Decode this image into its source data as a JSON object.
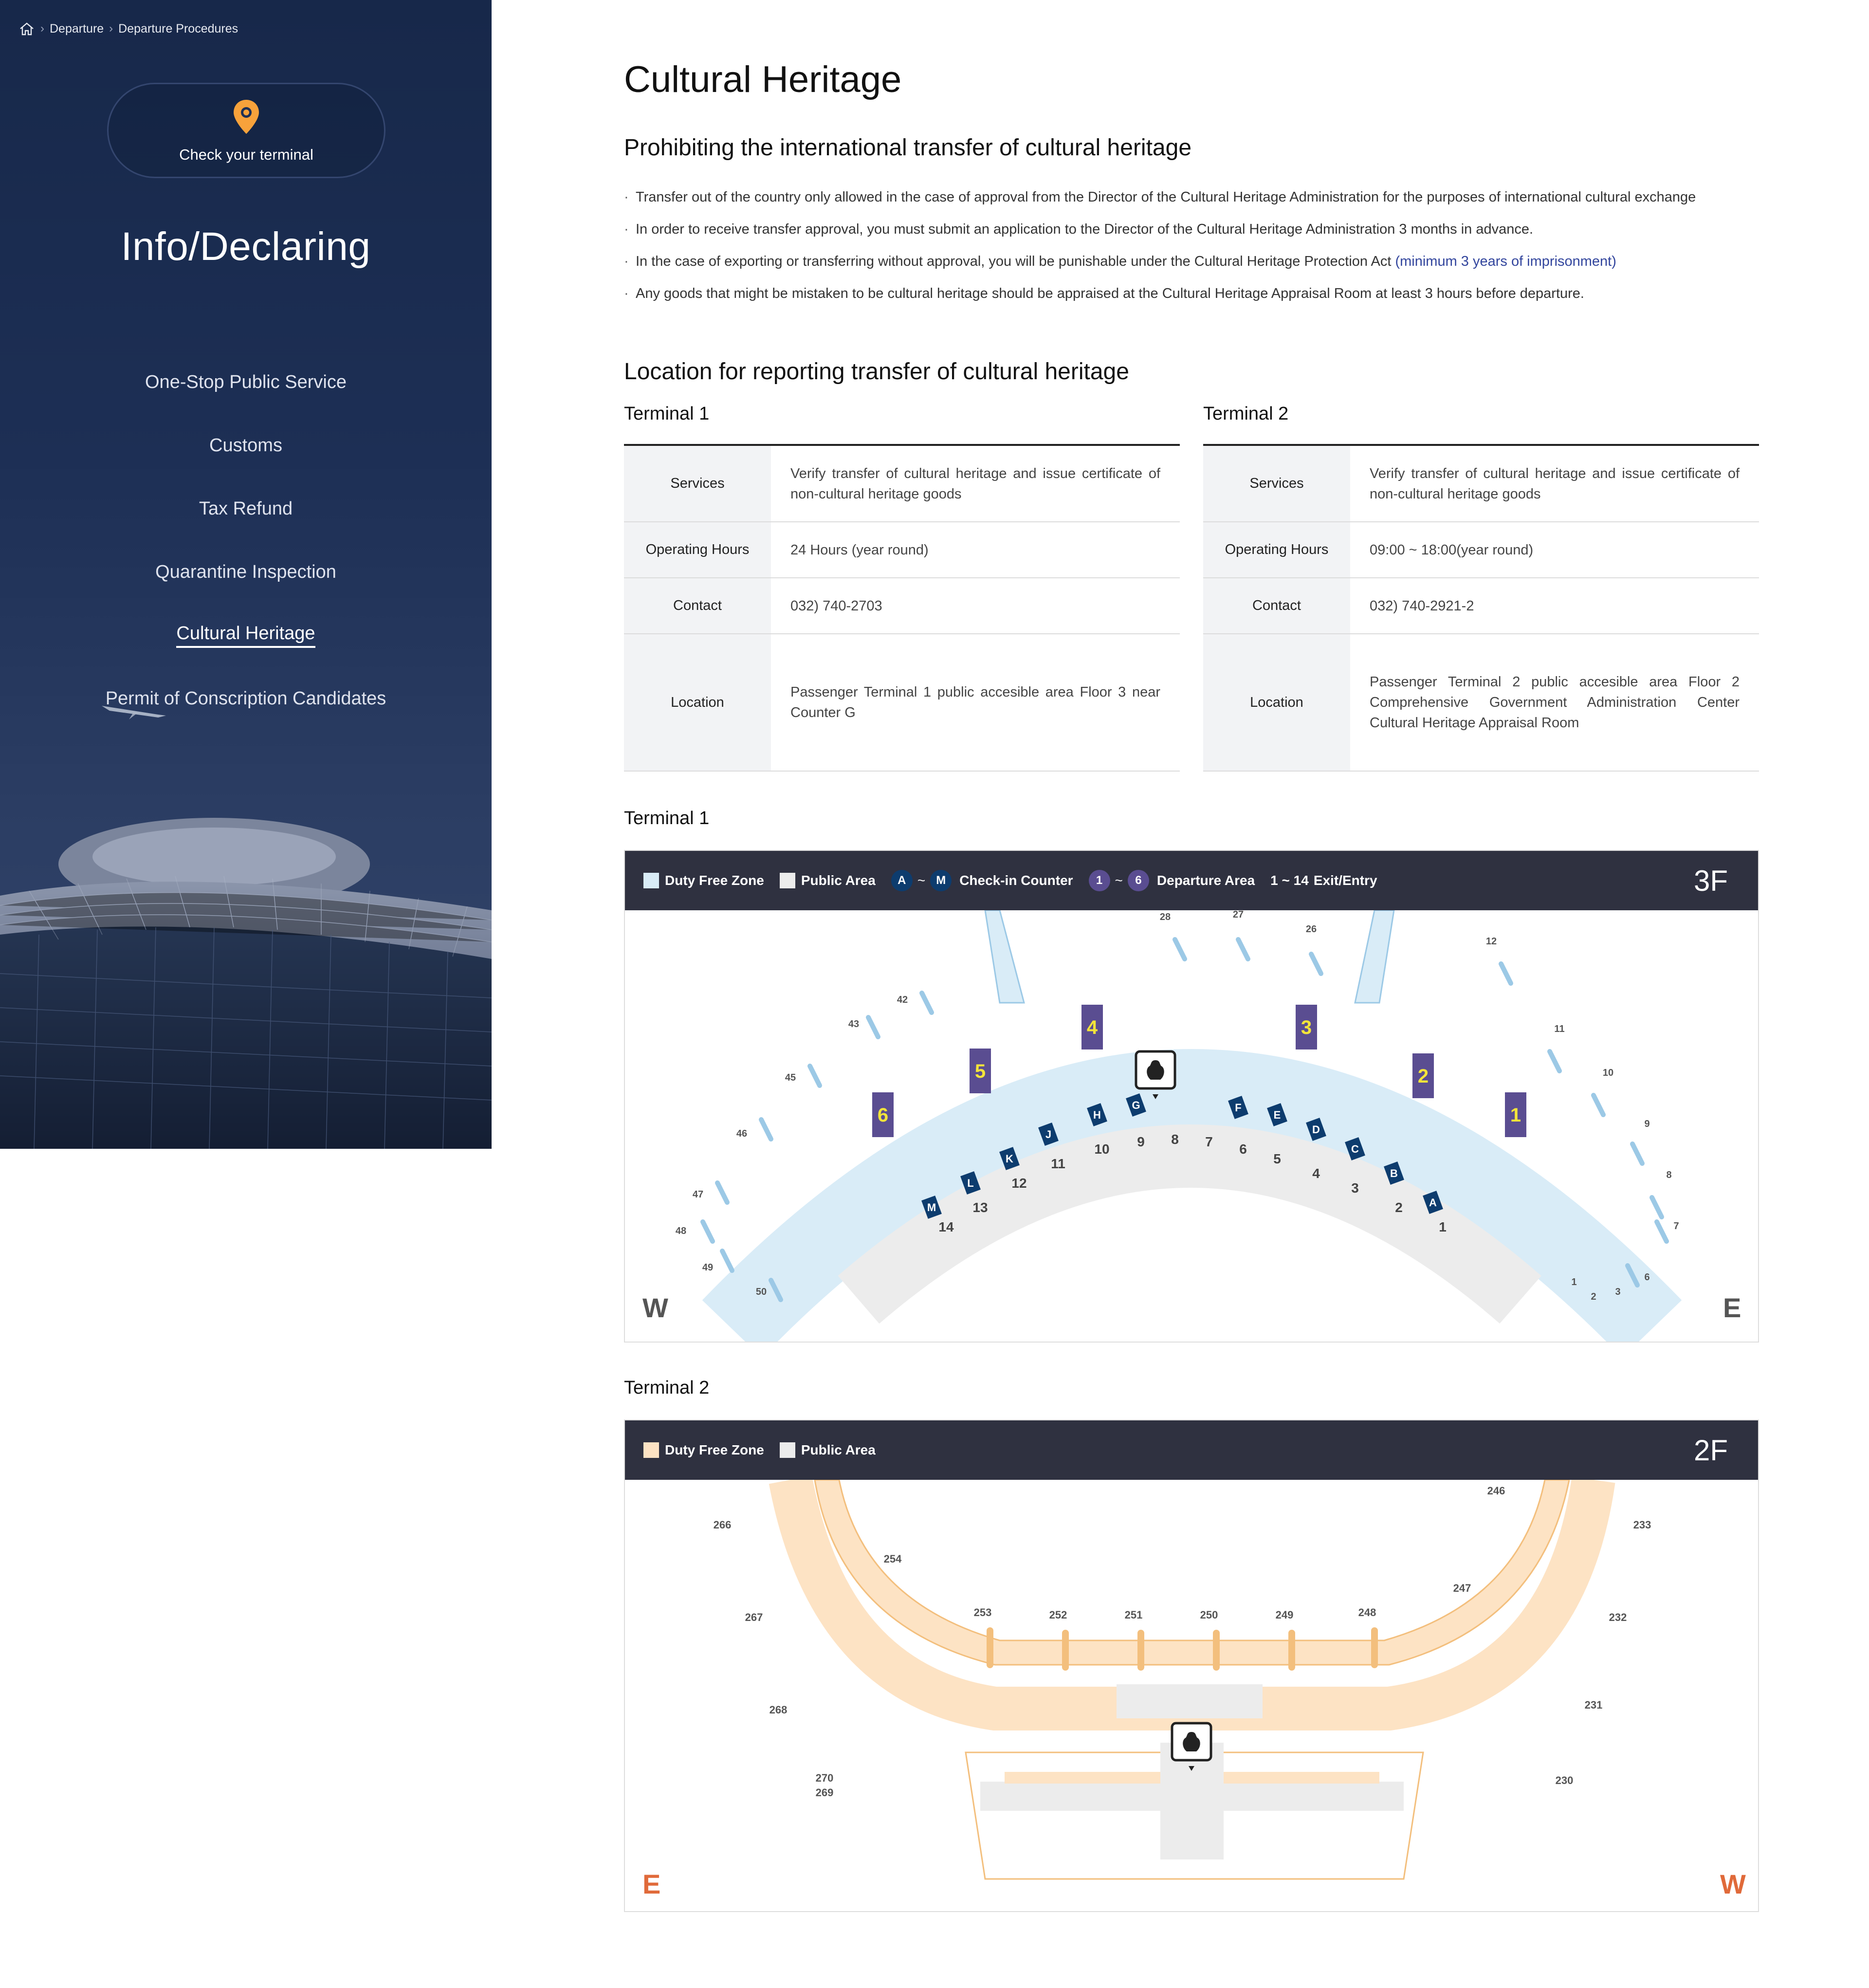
{
  "breadcrumb": {
    "home_icon": "home-icon",
    "items": [
      "Departure",
      "Departure Procedures"
    ]
  },
  "sidebar": {
    "terminal_button": "Check your terminal",
    "title": "Info/Declaring",
    "nav": [
      {
        "label": "One-Stop Public Service",
        "active": false
      },
      {
        "label": "Customs",
        "active": false
      },
      {
        "label": "Tax Refund",
        "active": false
      },
      {
        "label": "Quarantine Inspection",
        "active": false
      },
      {
        "label": "Cultural Heritage",
        "active": true
      },
      {
        "label": "Permit of Conscription Candidates",
        "active": false
      }
    ]
  },
  "main": {
    "title": "Cultural Heritage",
    "section1_title": "Prohibiting the international transfer of cultural heritage",
    "rules": [
      "Transfer out of the country only allowed in the case of approval from the Director of the Cultural Heritage Administration for the purposes of international cultural exchange",
      "In order to receive transfer approval, you must submit an application to the Director of the Cultural Heritage Administration 3 months in advance.",
      "In the case of exporting or transferring without approval, you will be punishable under the Cultural Heritage Protection Act",
      "Any goods that might be mistaken to be cultural heritage should be appraised at the Cultural Heritage Appraisal Room at least 3 hours before departure."
    ],
    "rule3_highlight": "(minimum 3 years of imprisonment)",
    "section2_title": "Location for reporting transfer of cultural heritage",
    "terminal1": {
      "name": "Terminal 1",
      "labels": {
        "services": "Services",
        "hours": "Operating Hours",
        "contact": "Contact",
        "location": "Location"
      },
      "services": "Verify transfer of cultural heritage and issue certificate of non-cultural heritage goods",
      "hours": "24 Hours (year round)",
      "contact": "032) 740-2703",
      "location": "Passenger Terminal 1 public accesible area Floor 3 near Counter G"
    },
    "terminal2": {
      "name": "Terminal 2",
      "labels": {
        "services": "Services",
        "hours": "Operating Hours",
        "contact": "Contact",
        "location": "Location"
      },
      "services": "Verify transfer of cultural heritage and issue certificate of non-cultural heritage goods",
      "hours": "09:00 ~ 18:00(year round)",
      "contact": "032) 740-2921-2",
      "location": "Passenger Terminal 2 public accesible area Floor 2 Comprehensive Government Administration Center Cultural Heritage Appraisal Room"
    }
  },
  "map1": {
    "title": "Terminal 1",
    "legend": {
      "duty_free": "Duty Free Zone",
      "public": "Public Area",
      "checkin_from": "A",
      "checkin_to": "M",
      "checkin_label": "Check-in Counter",
      "departure_from": "1",
      "departure_to": "6",
      "departure_label": "Departure Area",
      "exit_range": "1 ~ 14",
      "exit_label": "Exit/Entry",
      "tilde": "~"
    },
    "floor": "3F",
    "west": "W",
    "east": "E",
    "colors": {
      "duty_free": "#d9ecf7",
      "public": "#ececec",
      "checkin": "#0d3c6e",
      "departure": "#5a4d91",
      "departure_text": "#f3e43a"
    },
    "gates": [
      "50",
      "49",
      "48",
      "47",
      "46",
      "45",
      "43",
      "42",
      "28",
      "27",
      "26",
      "12",
      "11",
      "10",
      "9",
      "8",
      "7",
      "6",
      "3",
      "2",
      "1"
    ],
    "counters": [
      "M",
      "L",
      "K",
      "J",
      "H",
      "G",
      "F",
      "E",
      "D",
      "C",
      "B",
      "A"
    ],
    "departure_areas": [
      "6",
      "5",
      "4",
      "3",
      "2",
      "1"
    ],
    "exits": [
      "14",
      "13",
      "12",
      "11",
      "10",
      "9",
      "8",
      "7",
      "6",
      "5",
      "4",
      "3",
      "2",
      "1"
    ],
    "heritage_icon": "vase-icon"
  },
  "map2": {
    "title": "Terminal 2",
    "legend": {
      "duty_free": "Duty Free Zone",
      "public": "Public Area"
    },
    "floor": "2F",
    "east": "E",
    "west": "W",
    "colors": {
      "duty_free": "#fde3c4",
      "public": "#ececec",
      "compass": "#e06a3a"
    },
    "gates": [
      "266",
      "254",
      "267",
      "268",
      "270",
      "269",
      "253",
      "252",
      "251",
      "250",
      "249",
      "248",
      "247",
      "246",
      "233",
      "232",
      "231",
      "230"
    ],
    "heritage_icon": "vase-icon"
  }
}
